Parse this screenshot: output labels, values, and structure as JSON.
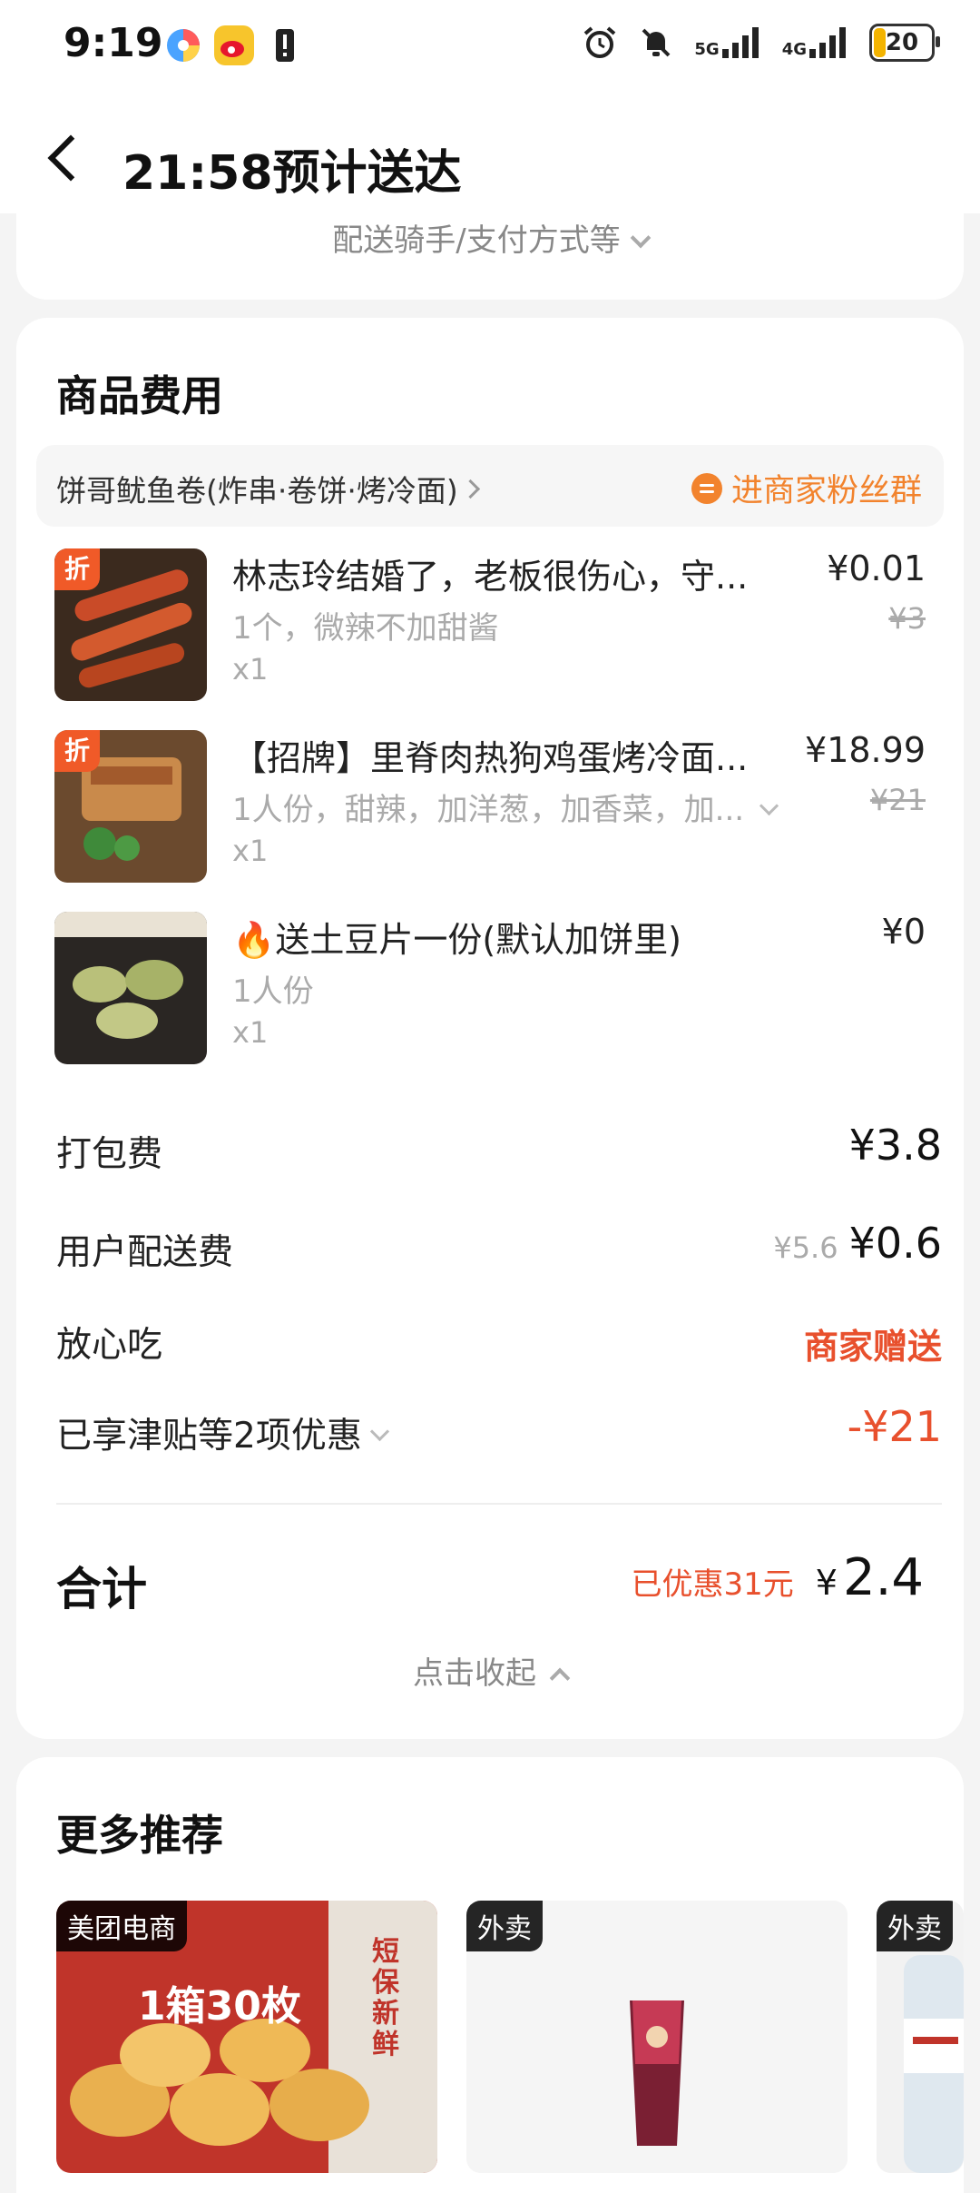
{
  "status_bar": {
    "time": "9:19",
    "battery": "20",
    "net1": "5G",
    "net2": "4G"
  },
  "header": {
    "title": "21:58预计送达"
  },
  "top_card": {
    "rider_payment": "配送骑手/支付方式等"
  },
  "goods": {
    "section_title": "商品费用",
    "shop_name": "饼哥鱿鱼卷(炸串·卷饼·烤冷面)",
    "fans_group": "进商家粉丝群",
    "items": [
      {
        "badge": "折",
        "name": "林志玲结婚了，老板很伤心，守...",
        "spec": "1个，微辣不加甜酱",
        "qty": "x1",
        "price": "¥0.01",
        "orig_price": "¥3"
      },
      {
        "badge": "折",
        "name": "【招牌】里脊肉热狗鸡蛋烤冷面...",
        "spec": "1人份，甜辣，加洋葱，加香菜，加...",
        "qty": "x1",
        "price": "¥18.99",
        "orig_price": "¥21"
      },
      {
        "badge": "",
        "name": "🔥送土豆片一份(默认加饼里)",
        "spec": "1人份",
        "qty": "x1",
        "price": "¥0",
        "orig_price": ""
      }
    ]
  },
  "fees": {
    "packing_label": "打包费",
    "packing_value": "¥3.8",
    "delivery_label": "用户配送费",
    "delivery_orig": "¥5.6",
    "delivery_value": "¥0.6",
    "assurance_label": "放心吃",
    "assurance_value": "商家赠送",
    "discount_label": "已享津贴等2项优惠",
    "discount_value": "-¥21"
  },
  "total": {
    "label": "合计",
    "saved": "已优惠31元",
    "currency": "¥",
    "value": "2.4",
    "collapse": "点击收起"
  },
  "recommend": {
    "title": "更多推荐",
    "items": [
      {
        "tag": "美团电商",
        "caption1": "1箱30枚",
        "caption2": "短保新鲜"
      },
      {
        "tag": "外卖"
      },
      {
        "tag": "外卖"
      }
    ]
  },
  "colors": {
    "accent_orange": "#f2832d",
    "discount_red": "#e8502d",
    "badge_orange": "#f05a28"
  }
}
